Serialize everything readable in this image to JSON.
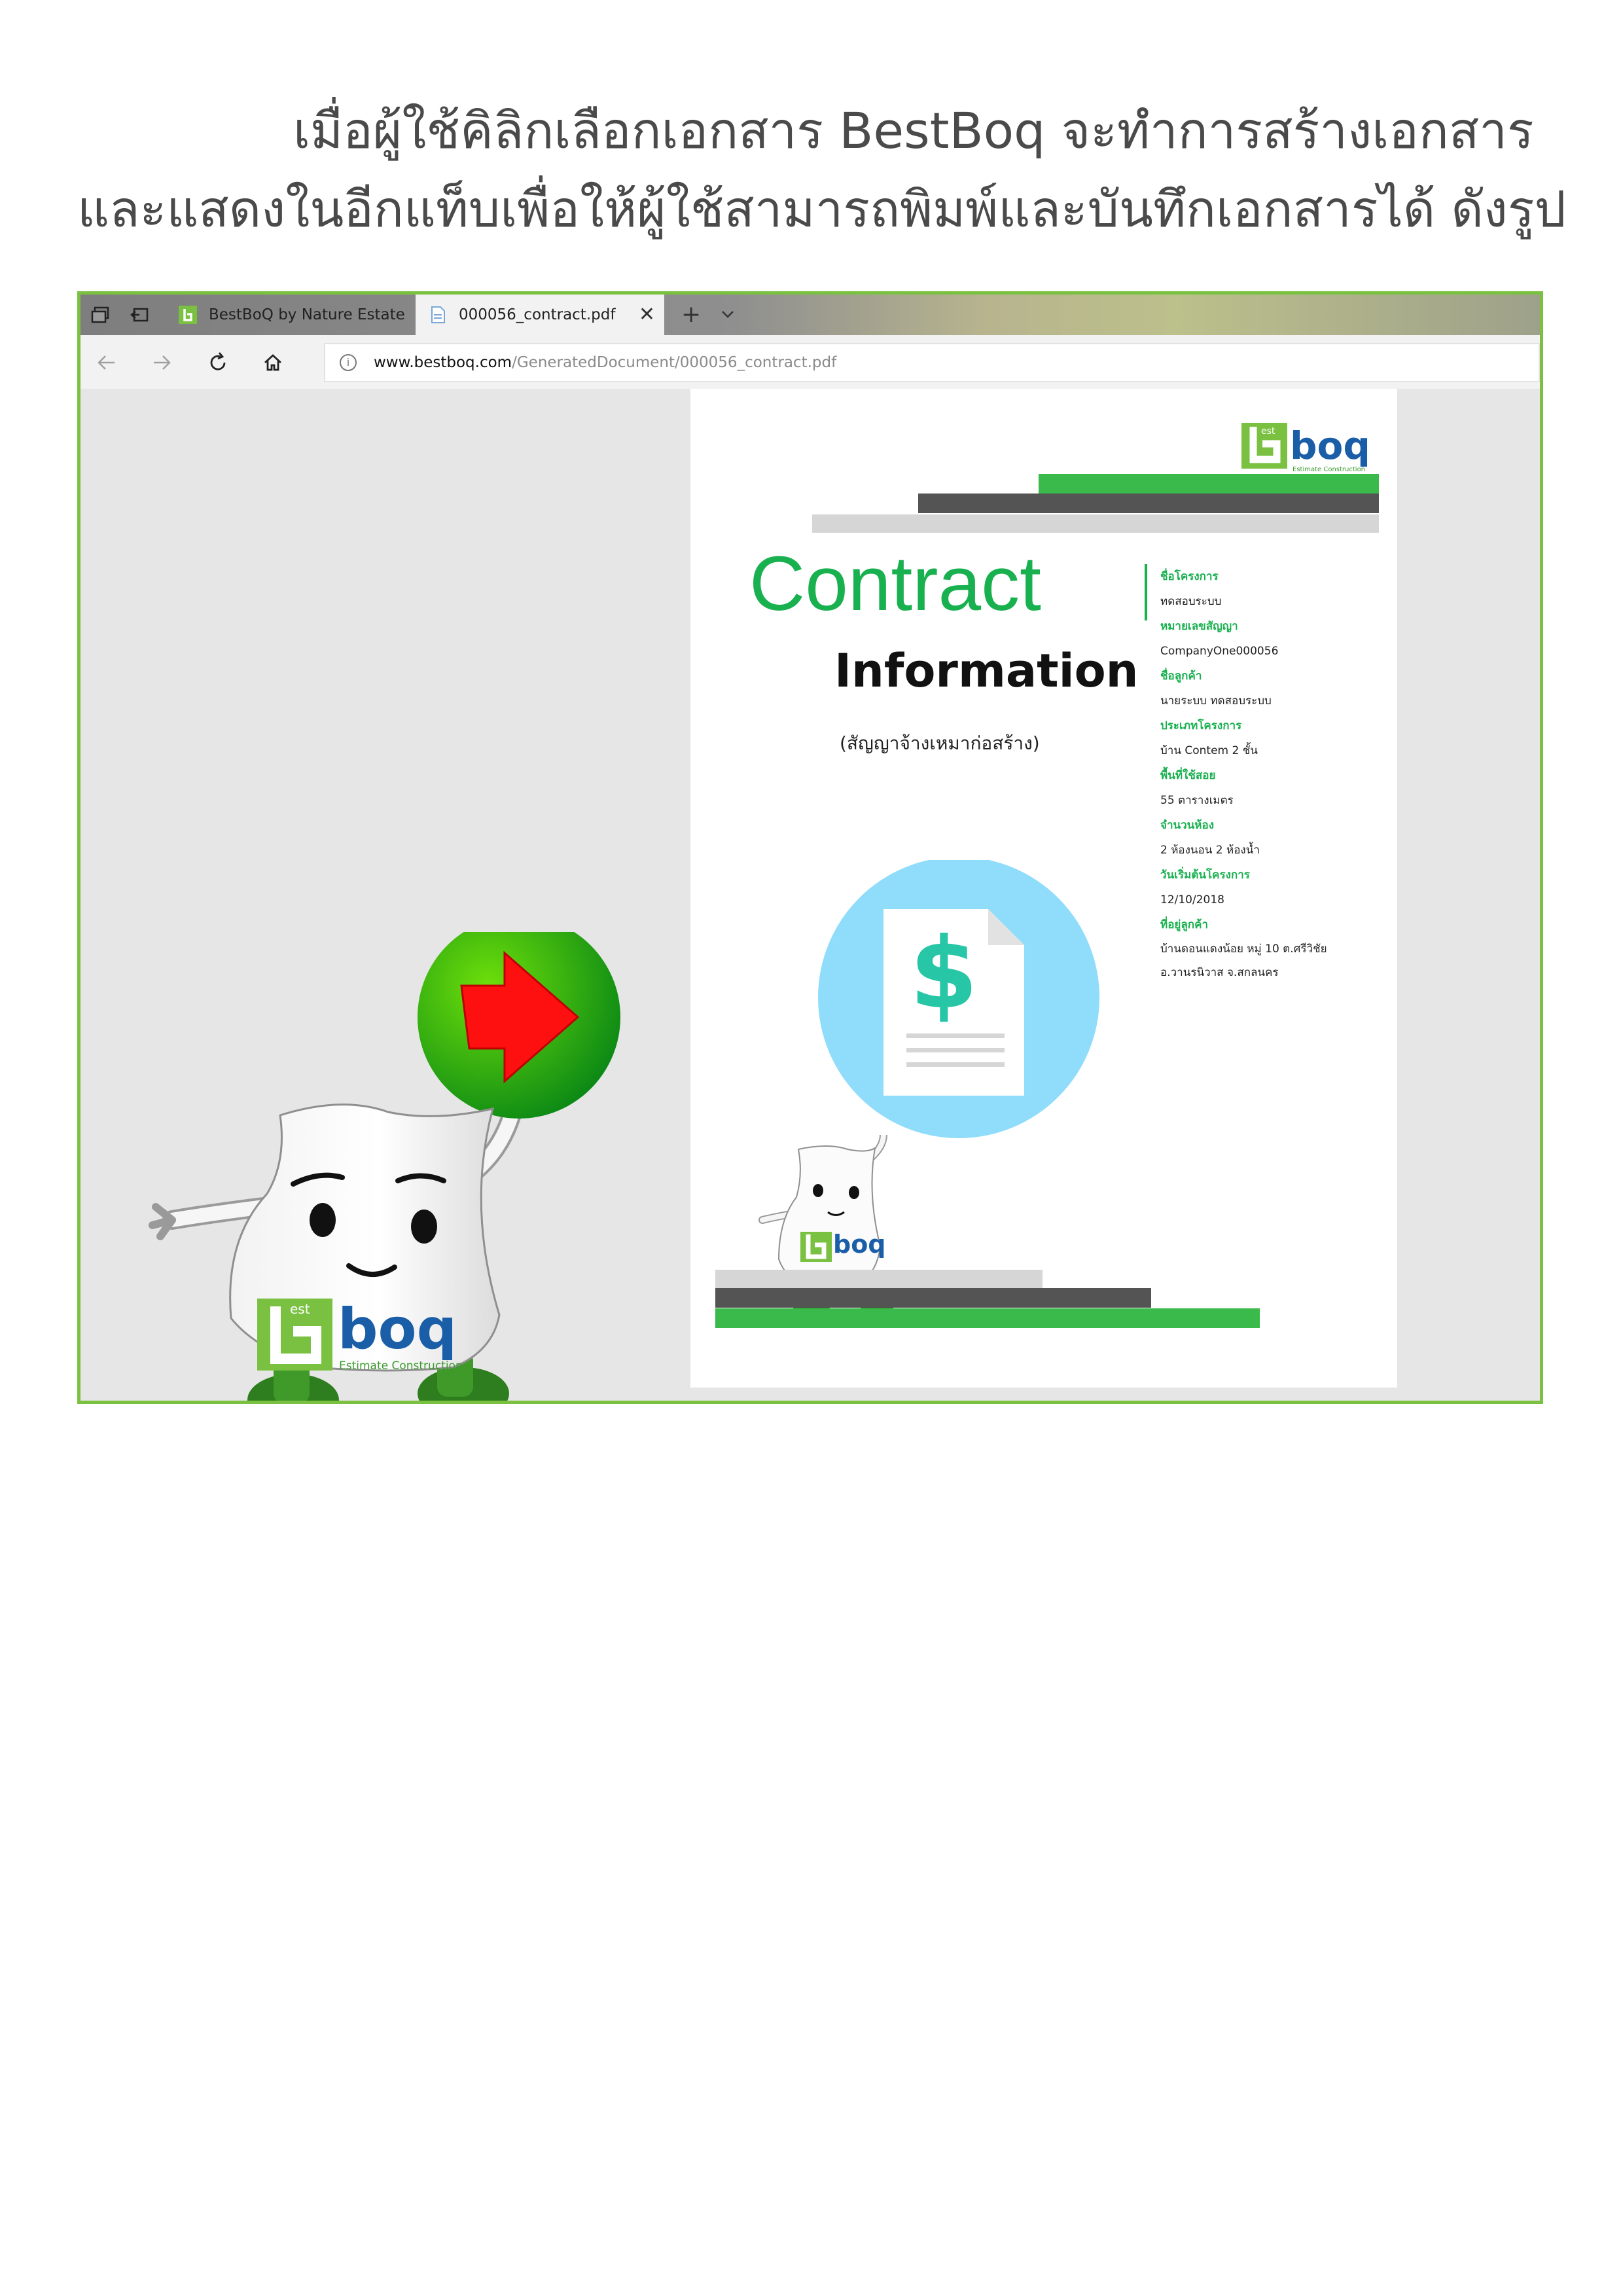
{
  "intro": {
    "line1": "เมื่อผู้ใช้คิลิกเลือกเอกสาร BestBoq จะทำการสร้างเอกสาร",
    "line2": "และแสดงในอีกแท็บเพื่อให้ผู้ใช้สามารถพิมพ์และบันทึกเอกสารได้ ดังรูป"
  },
  "browser": {
    "tabs": [
      {
        "label": "BestBoQ by Nature Estate",
        "active": false
      },
      {
        "label": "000056_contract.pdf",
        "active": true
      }
    ],
    "address": {
      "host": "www.bestboq.com",
      "path": "/GeneratedDocument/000056_contract.pdf"
    }
  },
  "document": {
    "logo_text": "boq",
    "logo_small": "est",
    "logo_tagline": "Estimate Construction",
    "title_1": "Contract",
    "title_2": "Information",
    "subtitle": "(สัญญาจ้างเหมาก่อสร้าง)",
    "fields": [
      {
        "label": "ชื่อโครงการ",
        "value": "ทดสอบระบบ"
      },
      {
        "label": "หมายเลขสัญญา",
        "value": "CompanyOne000056"
      },
      {
        "label": "ชื่อลูกค้า",
        "value": "นายระบบ ทดสอบระบบ"
      },
      {
        "label": "ประเภทโครงการ",
        "value": "บ้าน Contem 2 ชั้น"
      },
      {
        "label": "พื้นที่ใช้สอย",
        "value": "55 ตารางเมตร"
      },
      {
        "label": "จำนวนห้อง",
        "value": "2 ห้องนอน 2 ห้องน้ำ"
      },
      {
        "label": "วันเริ่มต้นโครงการ",
        "value": "12/10/2018"
      },
      {
        "label": "ที่อยู่ลูกค้า",
        "value": "บ้านดอนแดงน้อย หมู่ 10 ต.ศรีวิชัย",
        "value2": "อ.วานรนิวาส จ.สกลนคร"
      }
    ],
    "icon": "document-dollar-icon"
  },
  "mascot": {
    "logo_text": "boq",
    "logo_small": "est",
    "tagline": "Estimate Construction"
  },
  "colors": {
    "accent_green": "#19b150",
    "border_green": "#7ac142",
    "circle_blue": "#8fdcfb",
    "arrow_red": "#ff0000"
  }
}
